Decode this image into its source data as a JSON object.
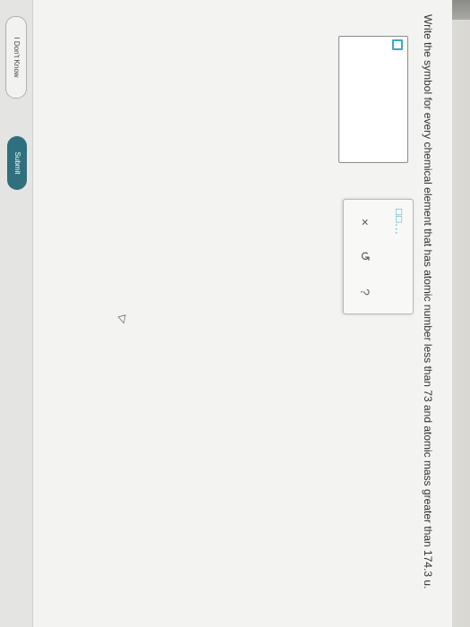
{
  "question": {
    "text": "Write the symbol for every chemical element that has atomic number less than 73 and atomic mass greater than 174.3 u."
  },
  "answer_box": {
    "value": ""
  },
  "toolbox": {
    "template_icon": "□□...",
    "clear_label": "×",
    "undo_label": "↺",
    "help_label": "?"
  },
  "footer": {
    "dont_know_label": "I Don't Know",
    "submit_label": "Submit"
  },
  "icons": [
    "template-icon",
    "clear-icon",
    "undo-icon",
    "help-icon",
    "mouse-pointer-icon"
  ],
  "colors": {
    "accent": "#3aa9c2",
    "submit": "#2f6f7e"
  }
}
